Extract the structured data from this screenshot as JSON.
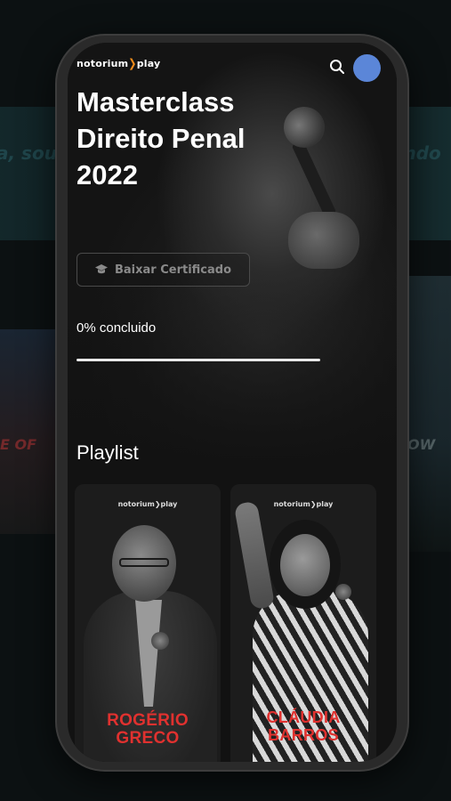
{
  "brand": {
    "logo_text": "notorium",
    "logo_arrow": "❯",
    "logo_suffix": "play"
  },
  "header": {
    "search_icon": "search-icon",
    "avatar_color": "#5b86d8"
  },
  "course": {
    "title": "Masterclass Direito Penal 2022",
    "certificate_button": "Baixar Certificado",
    "progress_label": "0% concluido",
    "progress_percent": 0
  },
  "playlist": {
    "title": "Playlist",
    "items": [
      {
        "name": "ROGÉRIO GRECO",
        "logo": "notorium❯play"
      },
      {
        "name": "CLÁUDIA BARROS",
        "logo": "notorium❯play"
      }
    ]
  },
  "colors": {
    "accent": "#f28c1b",
    "name_red": "#e0312f",
    "screen_bg": "#121212"
  }
}
